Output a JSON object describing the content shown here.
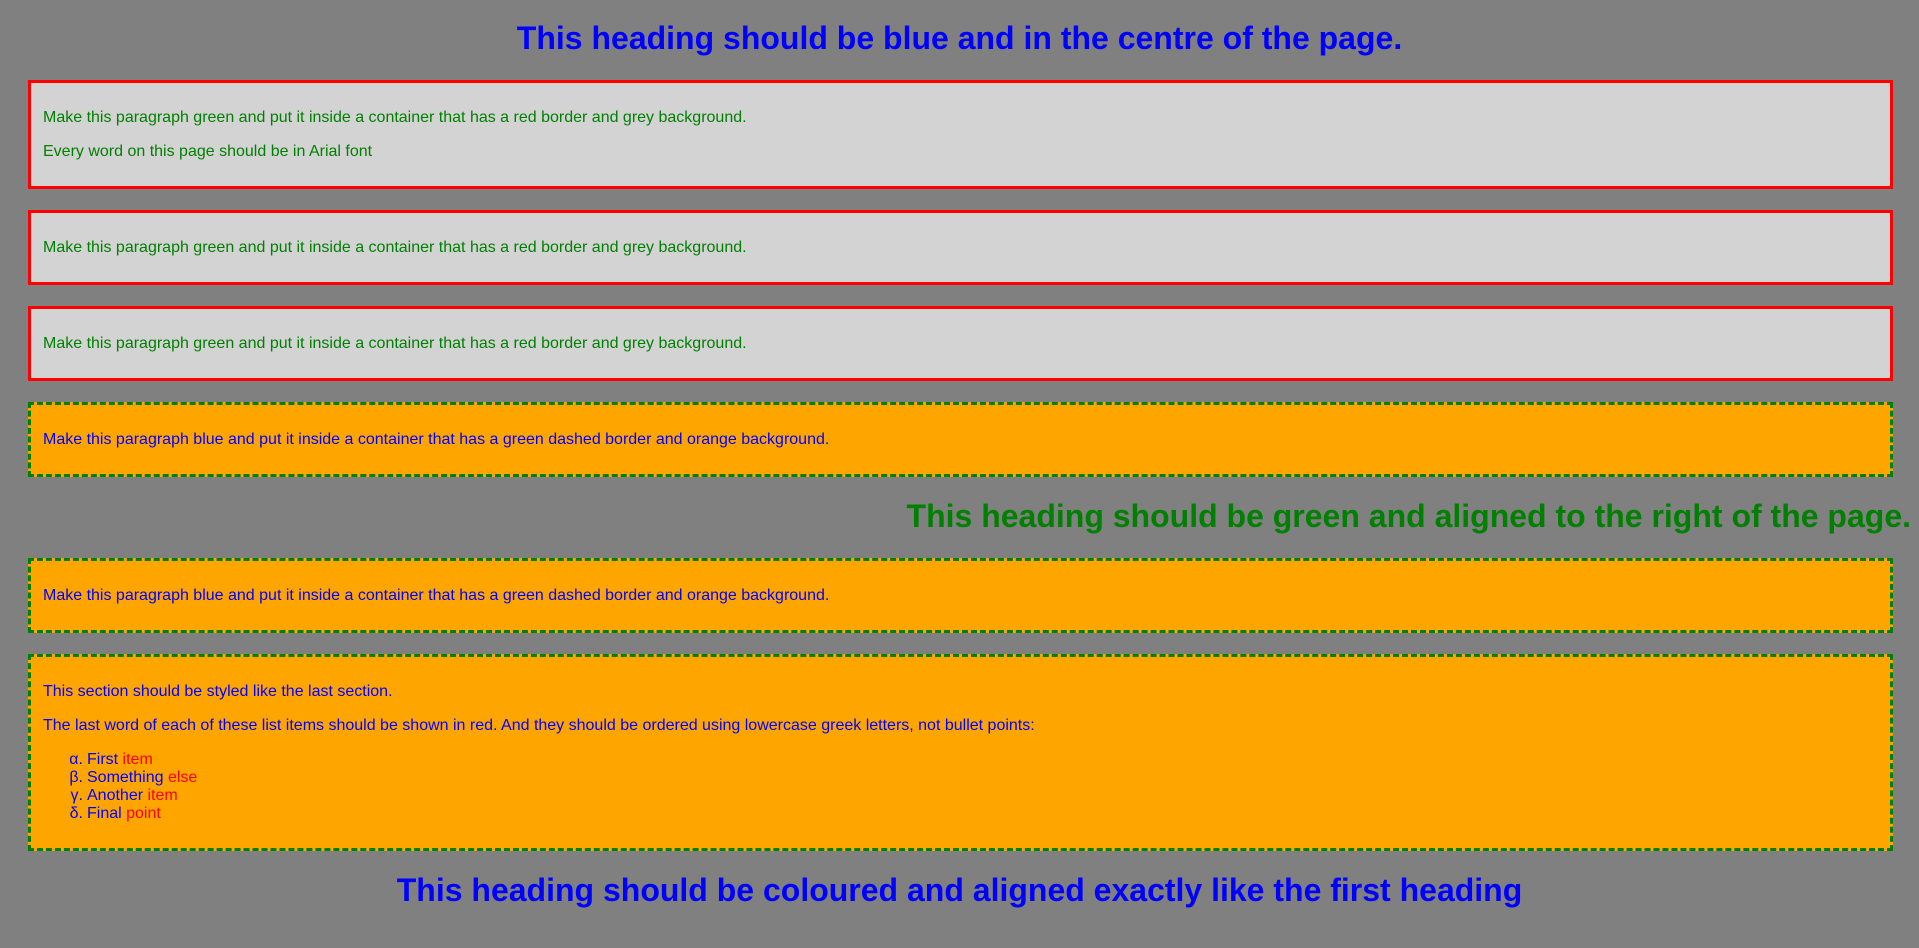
{
  "headings": {
    "first": "This heading should be blue and in the centre of the page.",
    "second": "This heading should be green and aligned to the right of the page.",
    "third": "This heading should be coloured and aligned exactly like the first heading"
  },
  "red_boxes": [
    {
      "p1": "Make this paragraph green and put it inside a container that has a red border and grey background.",
      "p2": "Every word on this page should be in Arial font"
    },
    {
      "p1": "Make this paragraph green and put it inside a container that has a red border and grey background."
    },
    {
      "p1": "Make this paragraph green and put it inside a container that has a red border and grey background."
    }
  ],
  "dash_boxes": [
    {
      "p1": "Make this paragraph blue and put it inside a container that has a green dashed border and orange background."
    },
    {
      "p1": "Make this paragraph blue and put it inside a container that has a green dashed border and orange background."
    }
  ],
  "last_section": {
    "p1": "This section should be styled like the last section.",
    "p2": "The last word of each of these list items should be shown in red. And they should be ordered using lowercase greek letters, not bullet points:",
    "items": [
      {
        "marker": "α.",
        "text": "First ",
        "red": "item"
      },
      {
        "marker": "β.",
        "text": "Something ",
        "red": "else"
      },
      {
        "marker": "γ.",
        "text": "Another ",
        "red": "item"
      },
      {
        "marker": "δ.",
        "text": "Final ",
        "red": "point"
      }
    ]
  },
  "colors": {
    "page_bg": "#808080",
    "red_box_bg": "#d3d3d3",
    "orange_box_bg": "#ffa500",
    "blue": "#0000ff",
    "green": "#008000",
    "red": "#ff0000"
  }
}
